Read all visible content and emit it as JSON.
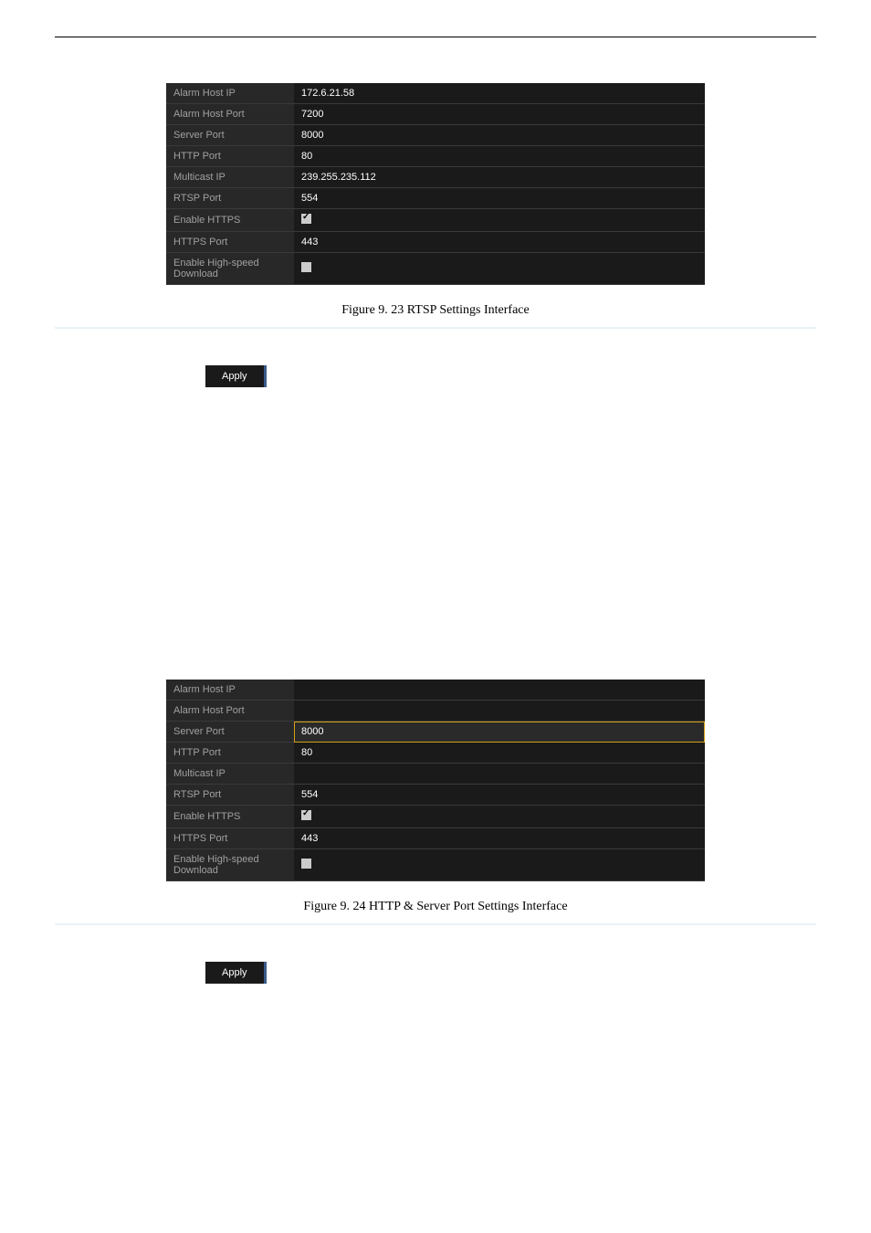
{
  "table1": {
    "rows": [
      {
        "label": "Alarm Host IP",
        "value": "172.6.21.58",
        "type": "text"
      },
      {
        "label": "Alarm Host Port",
        "value": "7200",
        "type": "text"
      },
      {
        "label": "Server Port",
        "value": "8000",
        "type": "text"
      },
      {
        "label": "HTTP Port",
        "value": "80",
        "type": "text"
      },
      {
        "label": "Multicast IP",
        "value": "239.255.235.112",
        "type": "text"
      },
      {
        "label": "RTSP Port",
        "value": "554",
        "type": "text"
      },
      {
        "label": "Enable HTTPS",
        "value": "",
        "type": "checkbox-checked"
      },
      {
        "label": "HTTPS Port",
        "value": "443",
        "type": "text"
      },
      {
        "label": "Enable High-speed Download",
        "value": "",
        "type": "checkbox-unchecked"
      }
    ]
  },
  "caption1": "Figure 9. 23  RTSP Settings Interface",
  "apply_label": "Apply",
  "table2": {
    "rows": [
      {
        "label": "Alarm Host IP",
        "value": "",
        "type": "text"
      },
      {
        "label": "Alarm Host Port",
        "value": "",
        "type": "text"
      },
      {
        "label": "Server Port",
        "value": "8000",
        "type": "text",
        "selected": true
      },
      {
        "label": "HTTP Port",
        "value": "80",
        "type": "text"
      },
      {
        "label": "Multicast IP",
        "value": "",
        "type": "text"
      },
      {
        "label": "RTSP Port",
        "value": "554",
        "type": "text"
      },
      {
        "label": "Enable HTTPS",
        "value": "",
        "type": "checkbox-checked"
      },
      {
        "label": "HTTPS Port",
        "value": "443",
        "type": "text"
      },
      {
        "label": "Enable High-speed Download",
        "value": "",
        "type": "checkbox-unchecked"
      }
    ]
  },
  "caption2": "Figure 9. 24  HTTP & Server Port Settings Interface"
}
